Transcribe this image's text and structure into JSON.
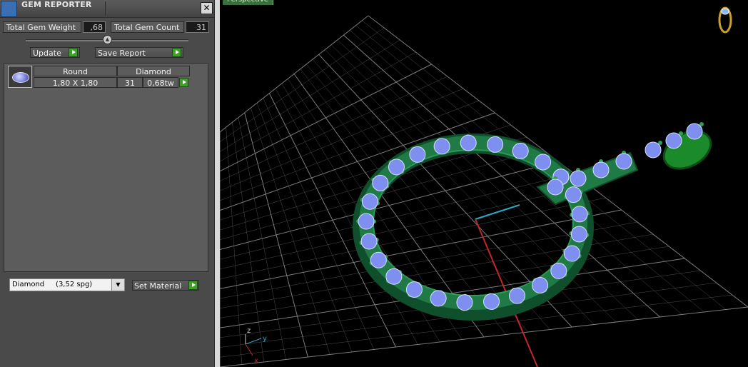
{
  "window": {
    "title": "GEM REPORTER",
    "close_glyph": "✕"
  },
  "totals": {
    "weight_label": "Total Gem Weight",
    "weight_value": ",68",
    "count_label": "Total Gem Count",
    "count_value": "31"
  },
  "buttons": {
    "update": "Update",
    "save_report": "Save Report",
    "set_material": "Set Material"
  },
  "gem_list": {
    "headers": [
      "Round",
      "Diamond"
    ],
    "rows": [
      {
        "size": "1,80 X 1,80",
        "count": "31",
        "weight": "0,68tw"
      }
    ]
  },
  "material_select": {
    "selected": "Diamond     (3,52 spg)",
    "arrow_glyph": "▼"
  },
  "viewport": {
    "tab_label": "Perspective",
    "axis_labels": {
      "z": "z",
      "y": "y",
      "x": "x"
    }
  },
  "colors": {
    "panel_bg": "#4a4a4a",
    "accent_green": "#3f9f2b",
    "grid_line": "#8a8a8a",
    "metal_green": "#1f7a45",
    "gem_blue": "#7f8ff0"
  },
  "icons": {
    "app": "gem-reporter-app-icon",
    "close": "close-icon",
    "go": "play-arrow-icon",
    "dropdown": "chevron-down-icon",
    "view_cube": "view-cube-icon"
  }
}
